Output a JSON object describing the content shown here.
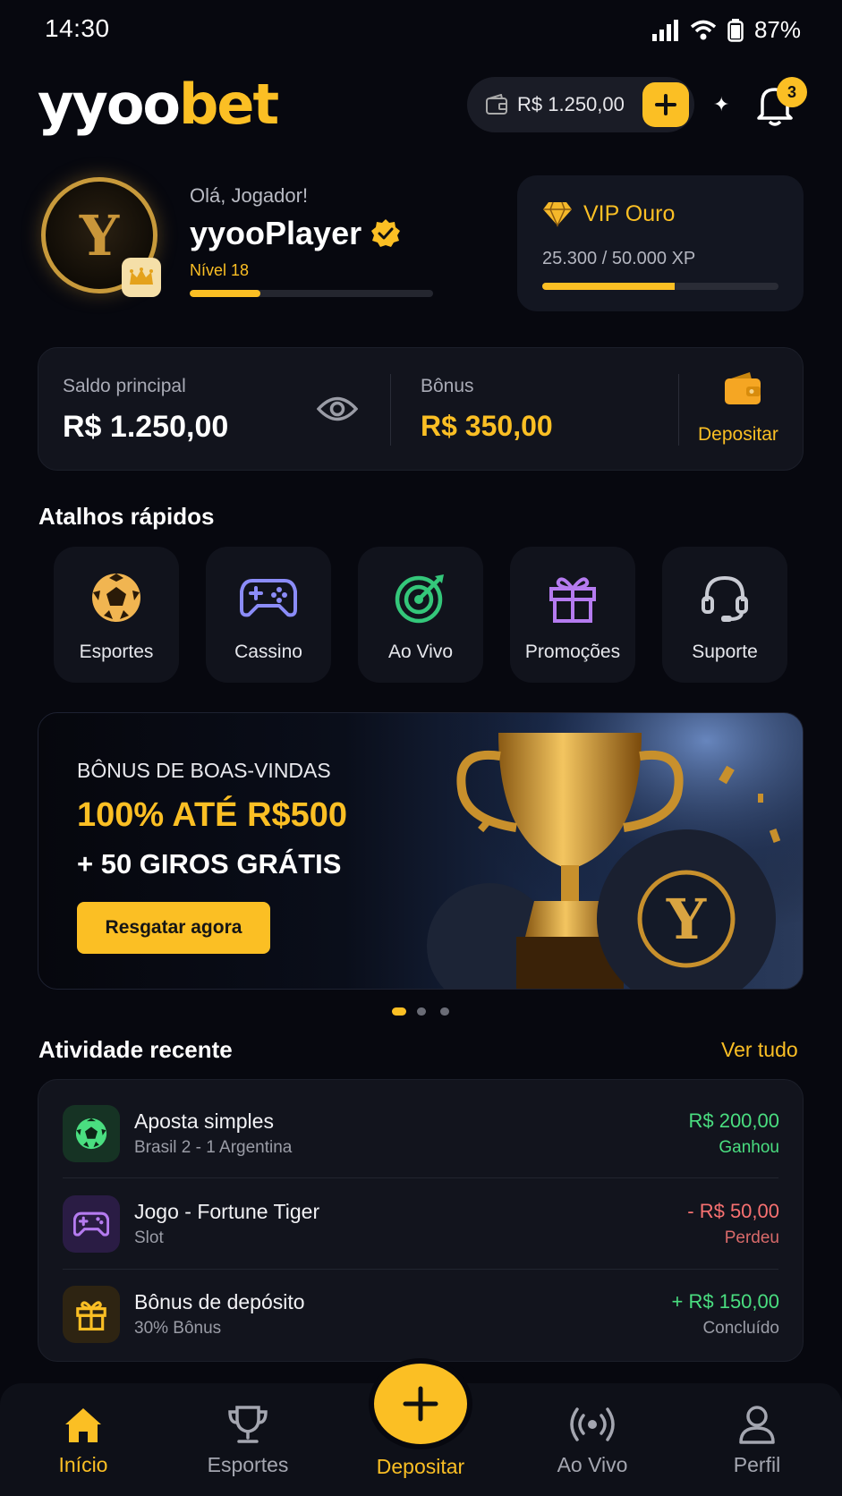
{
  "status_bar": {
    "time": "14:30",
    "battery": "87%"
  },
  "header": {
    "logo_white": "yyoo",
    "logo_gold": "bet",
    "balance": "R$ 1.250,00",
    "notification_count": "3"
  },
  "profile": {
    "greeting": "Olá, Jogador!",
    "username": "yyooPlayer",
    "level": "Nível 18",
    "level_progress": 0.29,
    "avatar_letter": "Y"
  },
  "vip": {
    "title": "VIP Ouro",
    "xp": "25.300 / 50.000 XP",
    "progress": 0.56
  },
  "balances": {
    "main_label": "Saldo principal",
    "main_value": "R$ 1.250,00",
    "bonus_label": "Bônus",
    "bonus_value": "R$ 350,00",
    "deposit_label": "Depositar"
  },
  "shortcuts": {
    "title": "Atalhos rápidos",
    "items": [
      {
        "label": "Esportes",
        "icon": "soccer-ball-icon"
      },
      {
        "label": "Cassino",
        "icon": "gamepad-icon"
      },
      {
        "label": "Ao Vivo",
        "icon": "target-icon"
      },
      {
        "label": "Promoções",
        "icon": "gift-icon"
      },
      {
        "label": "Suporte",
        "icon": "headset-icon"
      }
    ]
  },
  "banner": {
    "subtitle": "BÔNUS DE BOAS-VINDAS",
    "headline": "100% ATÉ R$500",
    "headline2": "+ 50 GIROS GRÁTIS",
    "cta": "Resgatar agora",
    "art_letter": "Y"
  },
  "recent": {
    "title": "Atividade recente",
    "see_all": "Ver tudo",
    "items": [
      {
        "title": "Aposta simples",
        "subtitle": "Brasil 2 - 1 Argentina",
        "amount": "R$ 200,00",
        "status": "Ganhou",
        "icon": "soccer-ball-icon"
      },
      {
        "title": "Jogo - Fortune Tiger",
        "subtitle": "Slot",
        "amount": "- R$ 50,00",
        "status": "Perdeu",
        "icon": "gamepad-icon"
      },
      {
        "title": "Bônus de depósito",
        "subtitle": "30% Bônus",
        "amount": "+ R$ 150,00",
        "status": "Concluído",
        "icon": "gift-icon"
      }
    ]
  },
  "nav": {
    "items": [
      {
        "label": "Início",
        "icon": "home-icon"
      },
      {
        "label": "Esportes",
        "icon": "trophy-icon"
      },
      {
        "label": "Depositar",
        "icon": "plus-icon"
      },
      {
        "label": "Ao Vivo",
        "icon": "live-icon"
      },
      {
        "label": "Perfil",
        "icon": "user-icon"
      }
    ]
  },
  "colors": {
    "accent": "#fbbf24",
    "background": "#07080f",
    "win": "#4ade80",
    "loss": "#f87171"
  }
}
